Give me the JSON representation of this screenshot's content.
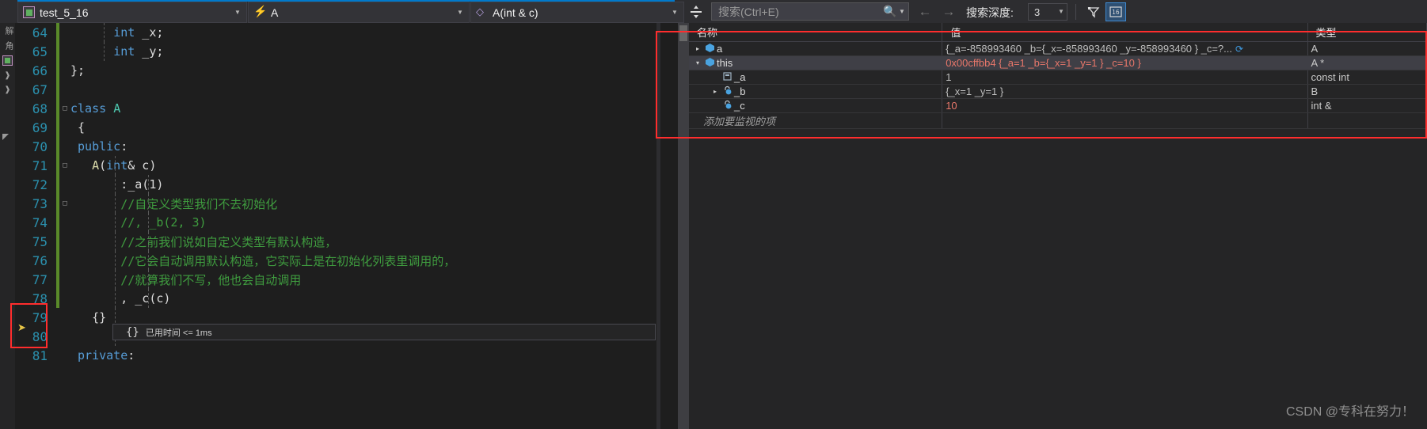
{
  "navbar": {
    "project": {
      "label": "test_5_16",
      "icon": "project-icon"
    },
    "class": {
      "label": "A",
      "icon": "class-icon"
    },
    "function": {
      "label": "A(int & c)",
      "icon": "method-icon"
    },
    "splitter_icon": "split-window-icon"
  },
  "toolbar": {
    "search_placeholder": "搜索(Ctrl+E)",
    "search_icon": "magnifier-icon",
    "search_dropdown_icon": "chevron-down-icon",
    "back_icon": "arrow-left-icon",
    "forward_icon": "arrow-right-icon",
    "depth_label": "搜索深度:",
    "depth_value": "3",
    "depth_dropdown_icon": "chevron-down-icon",
    "filter_icon": "filter-icon",
    "hex_icon": "hex-display-icon"
  },
  "leftrail": {
    "items": [
      {
        "label": "解",
        "name": "solution-explorer-tab"
      },
      {
        "label": "角",
        "name": "toolbox-tab"
      }
    ],
    "icons": [
      "project-box-icon",
      "chevron-right-icon",
      "chevron-right-icon",
      "triangle-icon"
    ]
  },
  "editor": {
    "first_line": 64,
    "lines": [
      {
        "n": 64,
        "mod": true,
        "fold": "",
        "guides": [
          112
        ],
        "tokens": [
          {
            "t": "      ",
            "c": "pun"
          },
          {
            "t": "int",
            "c": "kw"
          },
          {
            "t": " _x;",
            "c": "pun"
          }
        ]
      },
      {
        "n": 65,
        "mod": true,
        "fold": "",
        "guides": [
          112
        ],
        "tokens": [
          {
            "t": "      ",
            "c": "pun"
          },
          {
            "t": "int",
            "c": "kw"
          },
          {
            "t": " _y;",
            "c": "pun"
          }
        ]
      },
      {
        "n": 66,
        "mod": true,
        "fold": "",
        "guides": [],
        "tokens": [
          {
            "t": "};",
            "c": "pun"
          }
        ]
      },
      {
        "n": 67,
        "mod": true,
        "fold": "",
        "guides": [],
        "tokens": []
      },
      {
        "n": 68,
        "mod": true,
        "fold": "□",
        "guides": [],
        "tokens": [
          {
            "t": "class ",
            "c": "kw"
          },
          {
            "t": "A",
            "c": "typ"
          }
        ]
      },
      {
        "n": 69,
        "mod": true,
        "fold": "",
        "guides": [],
        "tokens": [
          {
            "t": " {",
            "c": "pun"
          }
        ]
      },
      {
        "n": 70,
        "mod": true,
        "fold": "",
        "guides": [],
        "tokens": [
          {
            "t": " ",
            "c": "pun"
          },
          {
            "t": "public",
            "c": "kw"
          },
          {
            "t": ":",
            "c": "pun"
          }
        ]
      },
      {
        "n": 71,
        "mod": true,
        "fold": "□",
        "guides": [
          126
        ],
        "tokens": [
          {
            "t": "   ",
            "c": "pun"
          },
          {
            "t": "A",
            "c": "fn"
          },
          {
            "t": "(",
            "c": "pun"
          },
          {
            "t": "int",
            "c": "kw"
          },
          {
            "t": "& c)",
            "c": "pun"
          }
        ]
      },
      {
        "n": 72,
        "mod": true,
        "fold": "",
        "guides": [
          126,
          168
        ],
        "tokens": [
          {
            "t": "       :_a(1)",
            "c": "pun"
          }
        ]
      },
      {
        "n": 73,
        "mod": true,
        "fold": "□",
        "guides": [
          126,
          168
        ],
        "tokens": [
          {
            "t": "       //自定义类型我们不去初始化",
            "c": "cmt"
          }
        ]
      },
      {
        "n": 74,
        "mod": true,
        "fold": "",
        "guides": [
          126,
          168
        ],
        "tokens": [
          {
            "t": "       //, _b(2, 3)",
            "c": "cmt"
          }
        ]
      },
      {
        "n": 75,
        "mod": true,
        "fold": "",
        "guides": [
          126,
          168
        ],
        "tokens": [
          {
            "t": "       //之前我们说如自定义类型有默认构造，",
            "c": "cmt"
          }
        ]
      },
      {
        "n": 76,
        "mod": true,
        "fold": "",
        "guides": [
          126,
          168
        ],
        "tokens": [
          {
            "t": "       //它会自动调用默认构造，它实际上是在初始化列表里调用的，",
            "c": "cmt"
          }
        ]
      },
      {
        "n": 77,
        "mod": true,
        "fold": "",
        "guides": [
          126,
          168
        ],
        "tokens": [
          {
            "t": "       //就算我们不写，他也会自动调用",
            "c": "cmt"
          }
        ]
      },
      {
        "n": 78,
        "mod": true,
        "fold": "",
        "guides": [
          126,
          168
        ],
        "tokens": [
          {
            "t": "       , _c(c)",
            "c": "pun"
          }
        ]
      },
      {
        "n": 79,
        "mod": false,
        "fold": "",
        "guides": [
          126
        ],
        "tokens": [
          {
            "t": "   {}",
            "c": "pun"
          }
        ]
      },
      {
        "n": 80,
        "mod": false,
        "fold": "",
        "guides": [
          126
        ],
        "tokens": []
      },
      {
        "n": 81,
        "mod": false,
        "fold": "",
        "guides": [],
        "tokens": [
          {
            "t": " ",
            "c": "pun"
          },
          {
            "t": "private",
            "c": "kw"
          },
          {
            "t": ":",
            "c": "pun"
          }
        ]
      }
    ],
    "elapsed_braces": "{}",
    "elapsed_text": "已用时间 <= 1ms",
    "breakpoint_arrow_icon": "current-statement-arrow-icon"
  },
  "watch": {
    "columns": [
      "名称",
      "值",
      "类型"
    ],
    "rows": [
      {
        "expander": "▸",
        "expanded": false,
        "indent": 1,
        "icon": "object-value-icon",
        "name": "a",
        "value": "{_a=-858993460 _b={_x=-858993460 _y=-858993460 } _c=?...",
        "value_changed": false,
        "has_refresh": true,
        "refresh_icon": "refresh-icon",
        "type": "A",
        "selected": false
      },
      {
        "expander": "▾",
        "expanded": true,
        "indent": 1,
        "icon": "object-value-icon",
        "name": "this",
        "value": "0x00cffbb4 {_a=1 _b={_x=1 _y=1 } _c=10 }",
        "value_changed": true,
        "has_refresh": false,
        "type": "A *",
        "selected": true
      },
      {
        "expander": "",
        "expanded": false,
        "indent": 2,
        "icon": "field-readonly-icon",
        "name": "_a",
        "value": "1",
        "value_changed": false,
        "has_refresh": false,
        "type": "const int",
        "selected": false
      },
      {
        "expander": "▸",
        "expanded": false,
        "indent": 2,
        "icon": "field-icon",
        "name": "_b",
        "value": "{_x=1 _y=1 }",
        "value_changed": false,
        "has_refresh": false,
        "type": "B",
        "selected": false
      },
      {
        "expander": "",
        "expanded": false,
        "indent": 2,
        "icon": "field-icon",
        "name": "_c",
        "value": "10",
        "value_changed": true,
        "has_refresh": false,
        "type": "int &",
        "selected": false
      }
    ],
    "add_watch_placeholder": "添加要监视的项"
  },
  "watermark": {
    "text": "CSDN @专科在努力！"
  },
  "colors": {
    "accent": "#007acc",
    "highlight_box": "#ff2d2d",
    "value_changed": "#e8776a",
    "comment": "#3f9c3f",
    "keyword": "#569cd6",
    "type": "#4ec9b0",
    "line_number": "#2b91af",
    "modified_bar": "#5a8a2a"
  }
}
